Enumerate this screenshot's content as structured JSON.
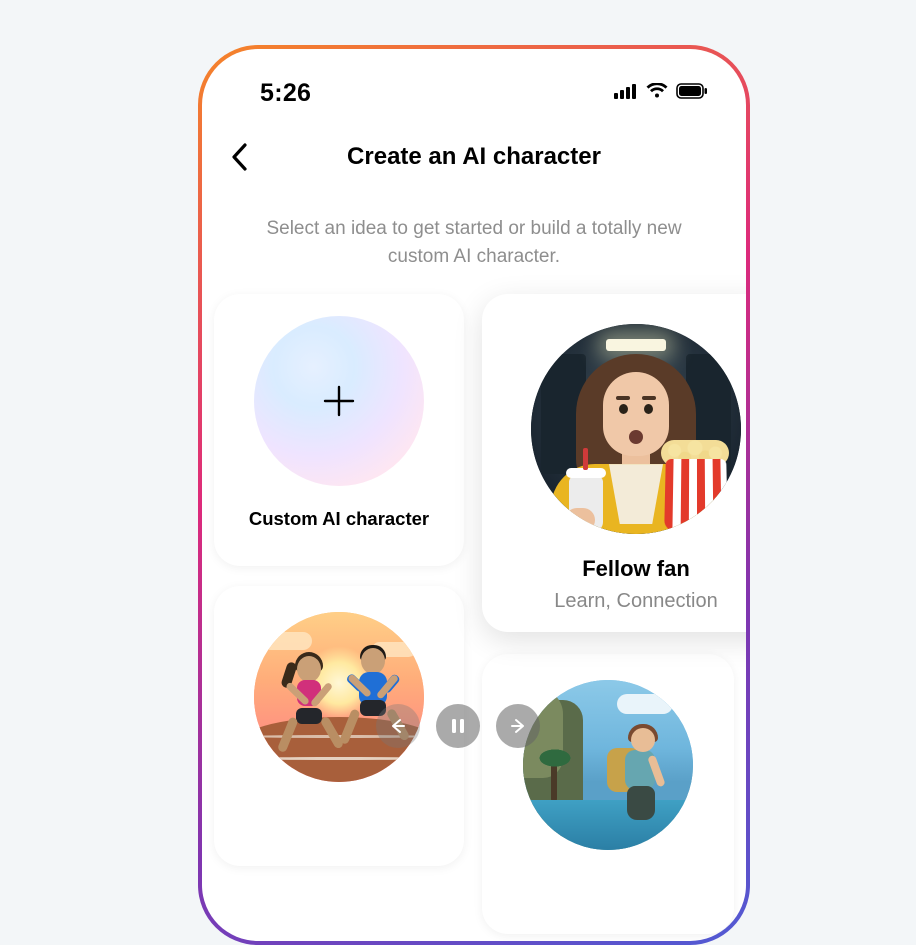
{
  "status": {
    "time": "5:26"
  },
  "header": {
    "title": "Create an AI character"
  },
  "subtitle": "Select an idea to get started or build a totally new custom AI character.",
  "cards": {
    "custom": {
      "label": "Custom AI character"
    },
    "featured": {
      "title": "Fellow fan",
      "subtitle": "Learn, Connection"
    }
  }
}
